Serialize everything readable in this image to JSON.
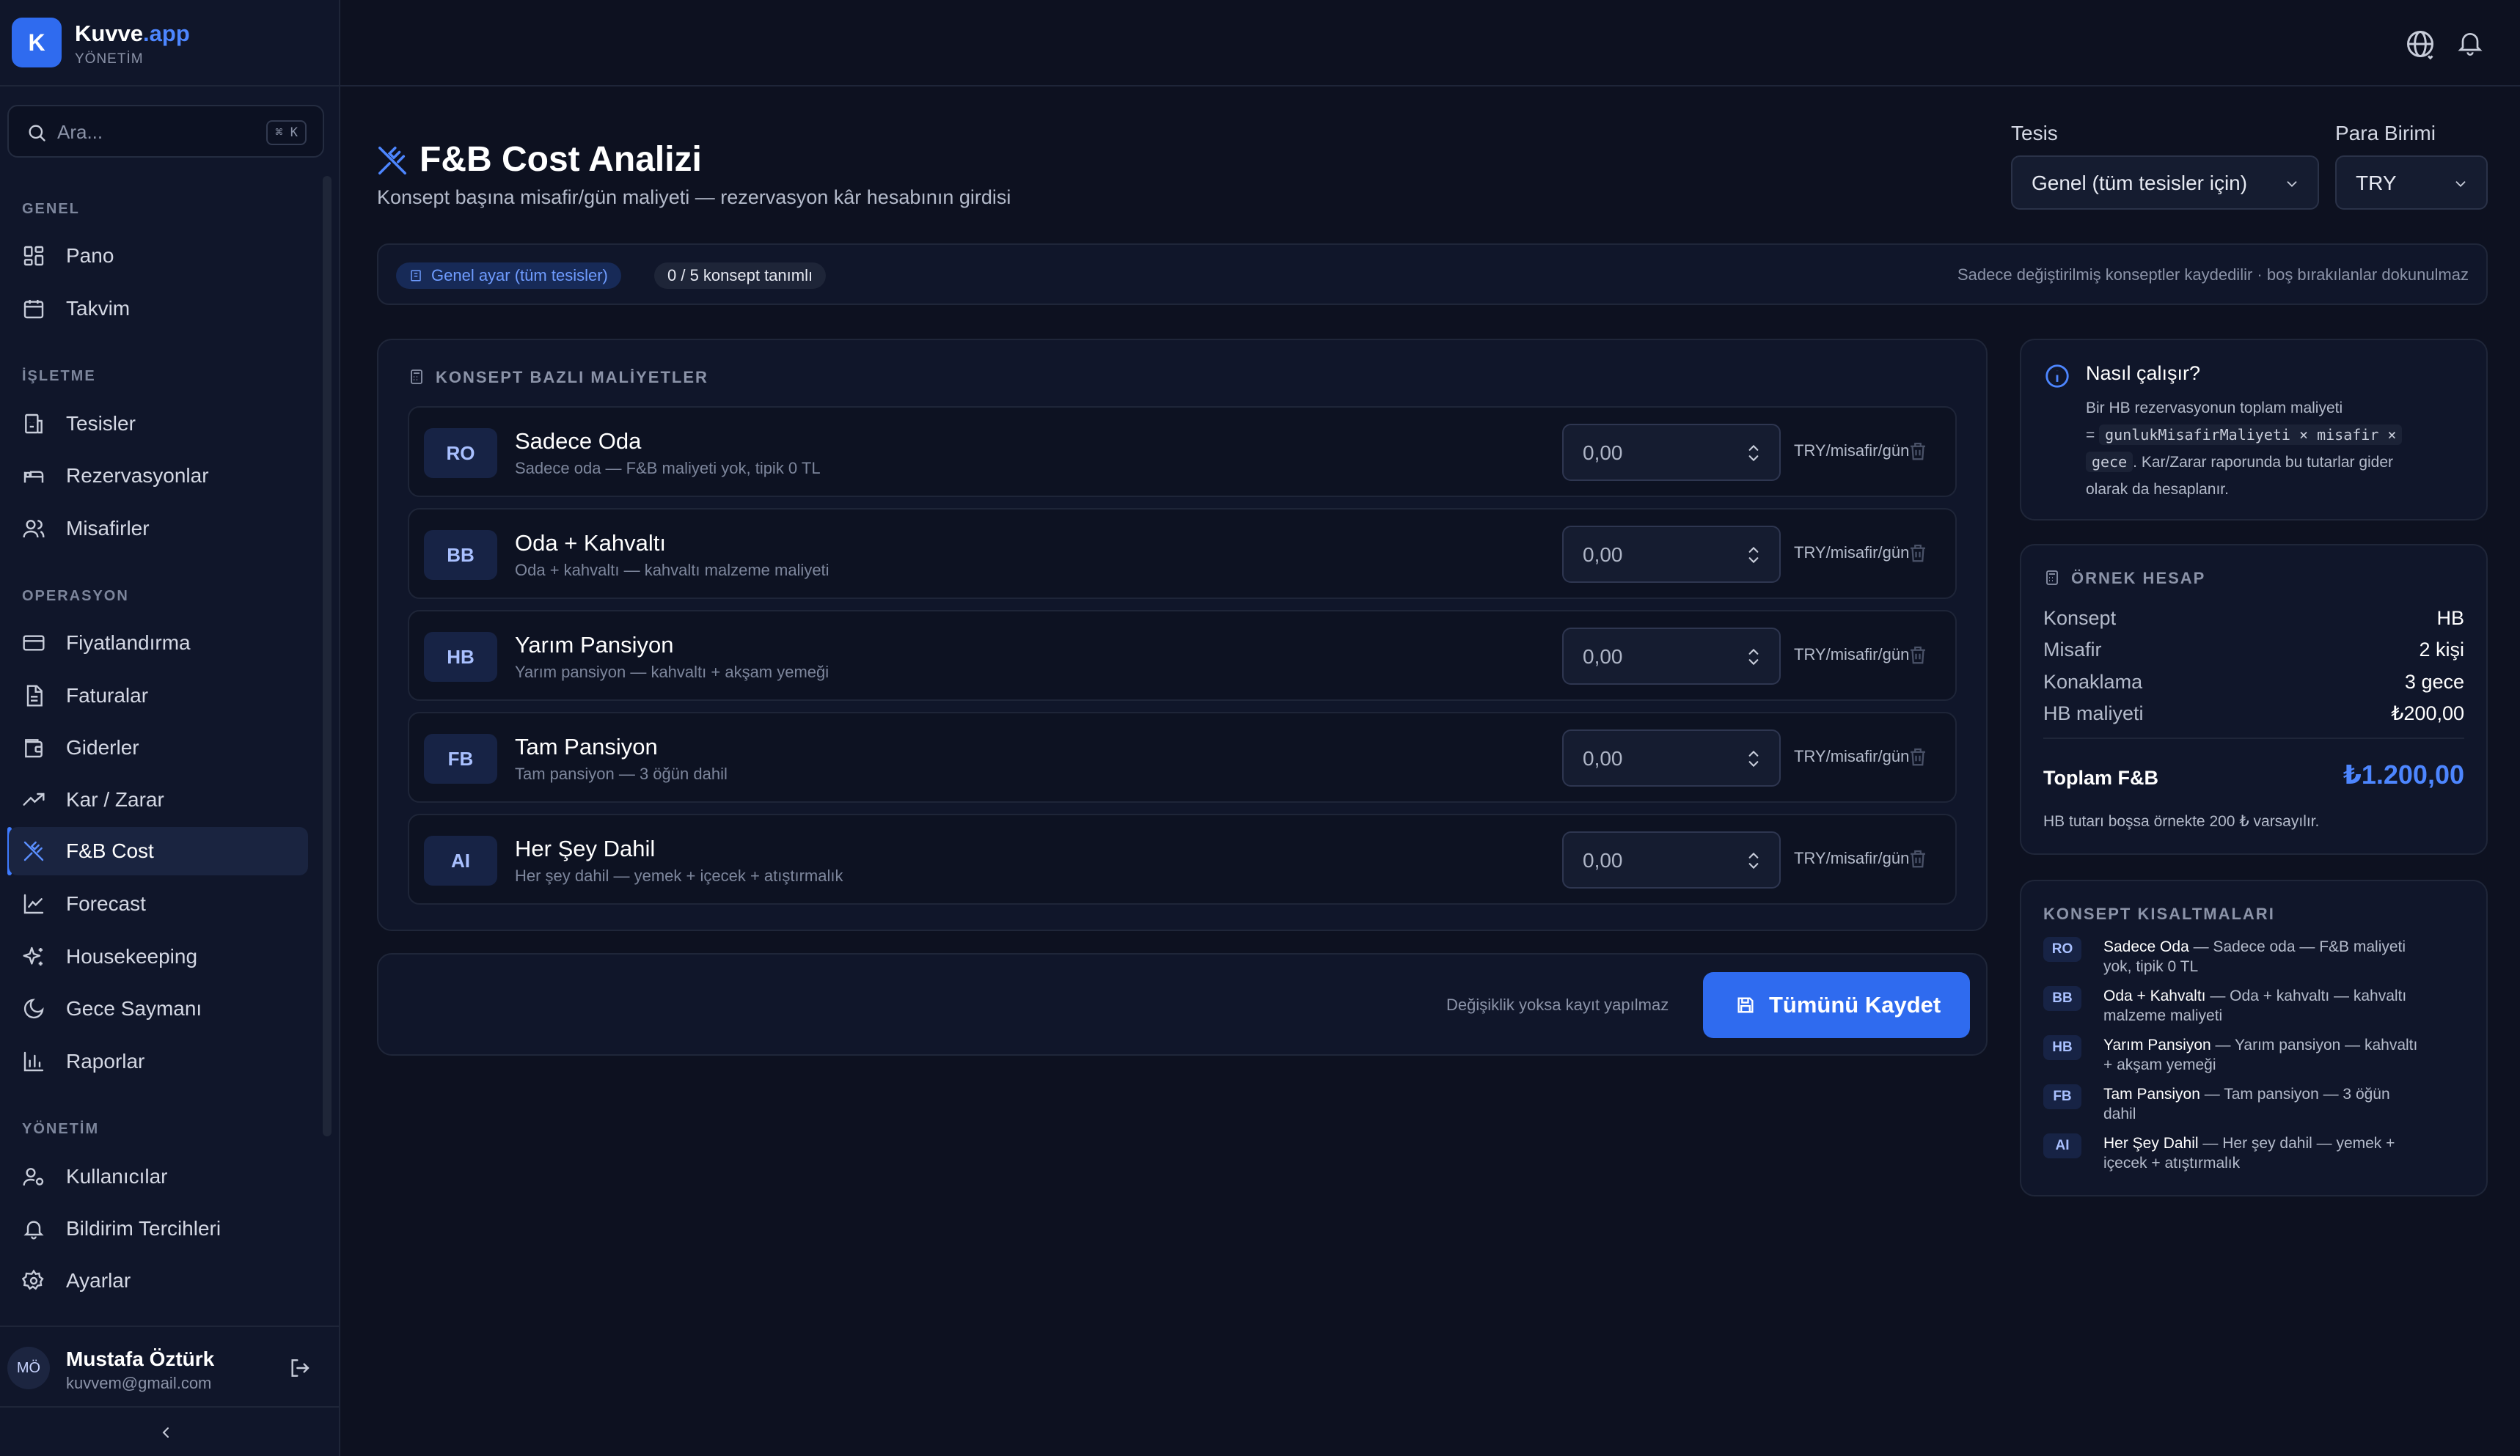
{
  "brand": {
    "logo_letter": "K",
    "name": "Kuvve",
    "name_accent": ".app",
    "subtitle": "YÖNETİM"
  },
  "search": {
    "placeholder": "Ara...",
    "shortcut": "⌘ K"
  },
  "nav": {
    "sections": [
      {
        "title": "GENEL",
        "items": [
          {
            "label": "Pano",
            "icon": "grid-icon"
          },
          {
            "label": "Takvim",
            "icon": "calendar-icon"
          }
        ]
      },
      {
        "title": "İŞLETME",
        "items": [
          {
            "label": "Tesisler",
            "icon": "building-icon"
          },
          {
            "label": "Rezervasyonlar",
            "icon": "bed-icon"
          },
          {
            "label": "Misafirler",
            "icon": "users-icon"
          }
        ]
      },
      {
        "title": "OPERASYON",
        "items": [
          {
            "label": "Fiyatlandırma",
            "icon": "credit-card-icon"
          },
          {
            "label": "Faturalar",
            "icon": "file-icon"
          },
          {
            "label": "Giderler",
            "icon": "wallet-icon"
          },
          {
            "label": "Kar / Zarar",
            "icon": "trending-up-icon"
          },
          {
            "label": "F&B Cost",
            "icon": "utensils-icon",
            "active": true
          },
          {
            "label": "Forecast",
            "icon": "line-chart-icon"
          },
          {
            "label": "Housekeeping",
            "icon": "sparkles-icon"
          },
          {
            "label": "Gece Saymanı",
            "icon": "moon-icon"
          },
          {
            "label": "Raporlar",
            "icon": "bar-chart-icon"
          }
        ]
      },
      {
        "title": "YÖNETİM",
        "items": [
          {
            "label": "Kullanıcılar",
            "icon": "user-cog-icon"
          },
          {
            "label": "Bildirim Tercihleri",
            "icon": "bell-icon"
          },
          {
            "label": "Ayarlar",
            "icon": "gear-icon"
          }
        ]
      }
    ]
  },
  "user": {
    "initials": "MÖ",
    "name": "Mustafa Öztürk",
    "email": "kuvvem@gmail.com"
  },
  "header": {
    "title": "F&B Cost Analizi",
    "subtitle": "Konsept başına misafir/gün maliyeti — rezervasyon kâr hesabının girdisi",
    "facility_label": "Tesis",
    "facility_value": "Genel (tüm tesisler için)",
    "currency_label": "Para Birimi",
    "currency_value": "TRY"
  },
  "strip": {
    "scope_pill": "Genel ayar (tüm tesisler)",
    "count_pill": "0 / 5 konsept tanımlı",
    "note": "Sadece değiştirilmiş konseptler kaydedilir · boş bırakılanlar dokunulmaz"
  },
  "concepts": {
    "title": "KONSEPT BAZLI MALİYETLER",
    "unit": "TRY/misafir/gün",
    "items": [
      {
        "code": "RO",
        "name": "Sadece Oda",
        "desc": "Sadece oda — F&B maliyeti yok, tipik 0 TL",
        "value": "0,00"
      },
      {
        "code": "BB",
        "name": "Oda + Kahvaltı",
        "desc": "Oda + kahvaltı — kahvaltı malzeme maliyeti",
        "value": "0,00"
      },
      {
        "code": "HB",
        "name": "Yarım Pansiyon",
        "desc": "Yarım pansiyon — kahvaltı + akşam yemeği",
        "value": "0,00"
      },
      {
        "code": "FB",
        "name": "Tam Pansiyon",
        "desc": "Tam pansiyon — 3 öğün dahil",
        "value": "0,00"
      },
      {
        "code": "AI",
        "name": "Her Şey Dahil",
        "desc": "Her şey dahil — yemek + içecek + atıştırmalık",
        "value": "0,00"
      }
    ]
  },
  "save": {
    "note": "Değişiklik yoksa kayıt yapılmaz",
    "button": "Tümünü Kaydet"
  },
  "how": {
    "title": "Nasıl çalışır?",
    "text_1": "Bir HB rezervasyonun toplam maliyeti",
    "text_eq": "= ",
    "formula_1": "gunlukMisafirMaliyeti × misafir ×",
    "formula_2": "gece",
    "text_2": ". Kar/Zarar raporunda bu tutarlar gider",
    "text_3": "olarak da hesaplanır."
  },
  "example": {
    "title": "ÖRNEK HESAP",
    "rows": [
      {
        "k": "Konsept",
        "v": "HB"
      },
      {
        "k": "Misafir",
        "v": "2 kişi"
      },
      {
        "k": "Konaklama",
        "v": "3 gece"
      },
      {
        "k": "HB maliyeti",
        "v": "₺200,00"
      }
    ],
    "total_label": "Toplam F&B",
    "total_value": "₺1.200,00",
    "note": "HB tutarı boşsa örnekte 200 ₺ varsayılır."
  },
  "abbr": {
    "title": "KONSEPT KISALTMALARI",
    "items": [
      {
        "code": "RO",
        "name": "Sadece Oda",
        "l1": " — Sadece oda — F&B maliyeti",
        "l2": "yok, tipik 0 TL"
      },
      {
        "code": "BB",
        "name": "Oda + Kahvaltı",
        "l1": " — Oda + kahvaltı — kahvaltı",
        "l2": "malzeme maliyeti"
      },
      {
        "code": "HB",
        "name": "Yarım Pansiyon",
        "l1": " — Yarım pansiyon — kahvaltı",
        "l2": "+ akşam yemeği"
      },
      {
        "code": "FB",
        "name": "Tam Pansiyon",
        "l1": " — Tam pansiyon — 3 öğün",
        "l2": "dahil"
      },
      {
        "code": "AI",
        "name": "Her Şey Dahil",
        "l1": " — Her şey dahil — yemek +",
        "l2": "içecek + atıştırmalık"
      }
    ]
  }
}
